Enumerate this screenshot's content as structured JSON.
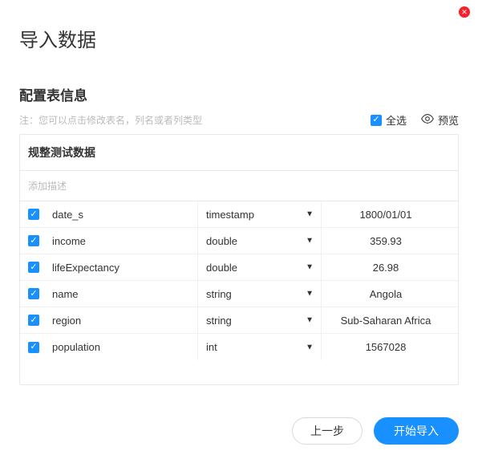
{
  "close_icon": "✕",
  "title": "导入数据",
  "section_title": "配置表信息",
  "hint": "注：您可以点击修改表名，列名或者列类型",
  "select_all": {
    "label": "全选",
    "checked": true
  },
  "preview": {
    "label": "预览"
  },
  "table_name": "规整测试数据",
  "desc_placeholder": "添加描述",
  "columns": [
    {
      "checked": true,
      "name": "date_s",
      "type": "timestamp",
      "sample": "1800/01/01"
    },
    {
      "checked": true,
      "name": "income",
      "type": "double",
      "sample": "359.93"
    },
    {
      "checked": true,
      "name": "lifeExpectancy",
      "type": "double",
      "sample": "26.98"
    },
    {
      "checked": true,
      "name": "name",
      "type": "string",
      "sample": "Angola"
    },
    {
      "checked": true,
      "name": "region",
      "type": "string",
      "sample": "Sub-Saharan Africa"
    },
    {
      "checked": true,
      "name": "population",
      "type": "int",
      "sample": "1567028"
    }
  ],
  "footer": {
    "prev": "上一步",
    "start": "开始导入"
  },
  "check_glyph": "✓"
}
